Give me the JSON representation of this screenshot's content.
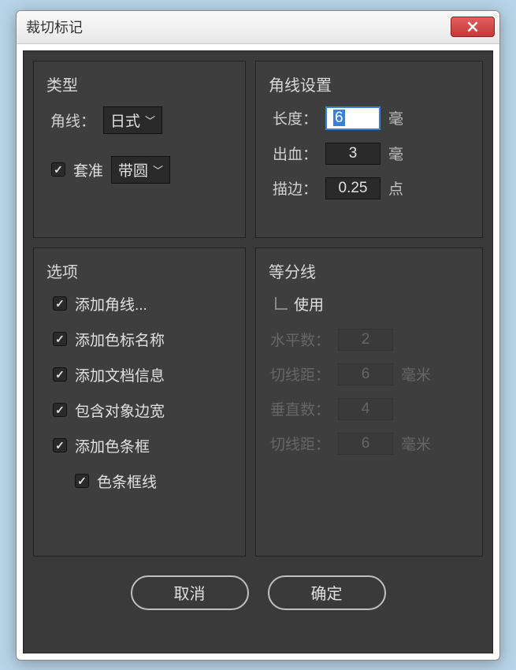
{
  "window": {
    "title": "裁切标记"
  },
  "type": {
    "title": "类型",
    "corner_label": "角线：",
    "corner_select": "日式",
    "registration_checked": true,
    "registration_label": "套准",
    "registration_select": "带圆"
  },
  "corner": {
    "title": "角线设置",
    "length_label": "长度：",
    "length_value": "6",
    "length_unit": "毫",
    "bleed_label": "出血：",
    "bleed_value": "3",
    "bleed_unit": "毫",
    "stroke_label": "描边：",
    "stroke_value": "0.25",
    "stroke_unit": "点"
  },
  "options": {
    "title": "选项",
    "items": [
      {
        "label": "添加角线...",
        "checked": true
      },
      {
        "label": "添加色标名称",
        "checked": true
      },
      {
        "label": "添加文档信息",
        "checked": true
      },
      {
        "label": "包含对象边宽",
        "checked": true
      },
      {
        "label": "添加色条框",
        "checked": true
      },
      {
        "label": "色条框线",
        "checked": true,
        "indent": true
      }
    ]
  },
  "division": {
    "title": "等分线",
    "use_label": "使用",
    "use_checked": false,
    "h_count_label": "水平数：",
    "h_count_value": "2",
    "h_dist_label": "切线距：",
    "h_dist_value": "6",
    "h_dist_unit": "毫米",
    "v_count_label": "垂直数：",
    "v_count_value": "4",
    "v_dist_label": "切线距：",
    "v_dist_value": "6",
    "v_dist_unit": "毫米"
  },
  "buttons": {
    "cancel": "取消",
    "ok": "确定"
  }
}
